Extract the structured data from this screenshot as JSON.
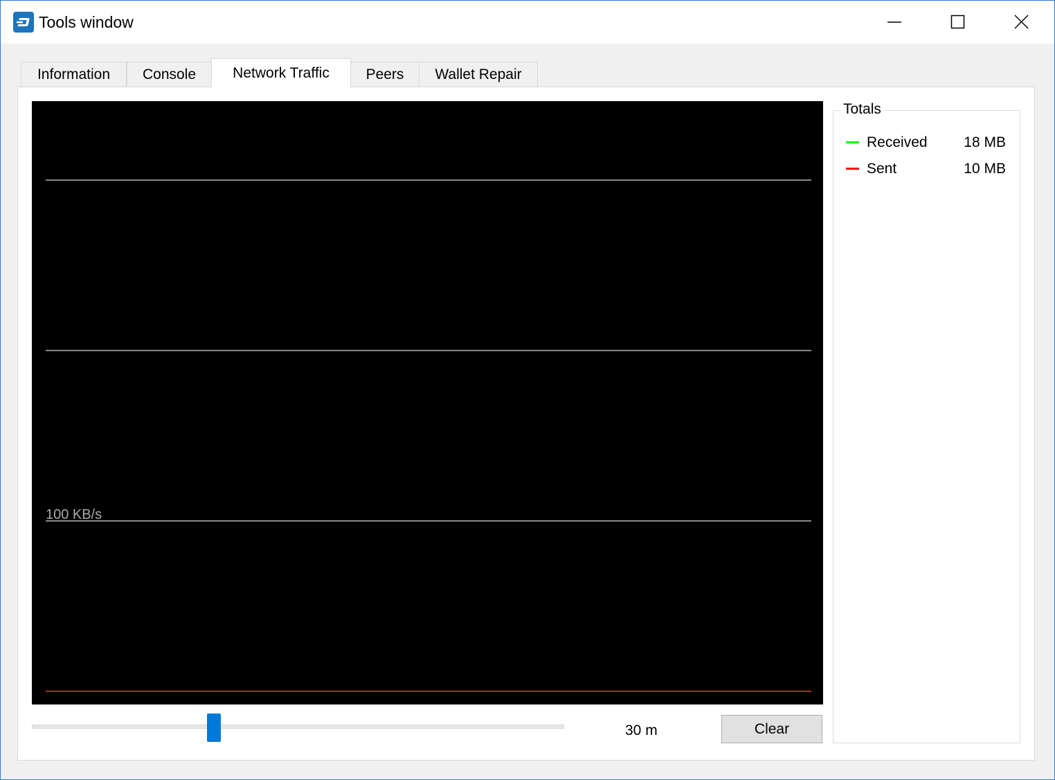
{
  "window": {
    "title": "Tools window",
    "accent": "#2b79d7",
    "app_icon": "dash-logo-icon",
    "controls": [
      "minimize-icon",
      "maximize-icon",
      "close-icon"
    ]
  },
  "tabs": [
    {
      "label": "Information",
      "active": false
    },
    {
      "label": "Console",
      "active": false
    },
    {
      "label": "Network Traffic",
      "active": true
    },
    {
      "label": "Peers",
      "active": false
    },
    {
      "label": "Wallet Repair",
      "active": false
    }
  ],
  "traffic": {
    "scale_label": "100 KB/s",
    "slider_value": "30 m",
    "clear_label": "Clear",
    "slider_position": 0.338
  },
  "totals": {
    "title": "Totals",
    "received": {
      "label": "Received",
      "value": "18 MB",
      "color": "#00ff00"
    },
    "sent": {
      "label": "Sent",
      "value": "10 MB",
      "color": "#ff0000"
    }
  },
  "chart_data": {
    "type": "area",
    "ylabel": "",
    "gridline_kbps": [
      100,
      200,
      300
    ],
    "ylim": [
      0,
      337
    ],
    "x_samples": 100,
    "series": [
      {
        "name": "Received",
        "color": "#00ff00",
        "values": [
          0,
          0,
          0,
          0,
          0,
          0,
          0,
          0,
          0,
          0,
          0,
          0,
          0,
          0,
          0,
          0,
          0,
          0,
          0,
          0,
          0,
          0,
          0,
          0,
          0,
          0,
          0,
          0,
          0,
          0,
          0,
          0,
          0,
          0,
          0,
          0,
          0,
          0,
          0,
          0,
          0,
          0,
          0,
          0,
          0,
          0,
          0,
          0,
          0,
          0,
          0,
          0,
          0,
          0,
          0,
          0,
          0,
          0,
          0,
          0,
          0,
          0,
          0,
          0,
          0,
          0,
          0,
          0,
          0,
          0,
          0,
          0,
          0,
          0,
          0,
          0,
          0,
          0,
          0,
          0,
          0,
          0,
          0,
          0,
          0,
          0,
          0,
          0,
          0,
          0,
          0,
          0,
          0,
          0,
          0,
          0,
          0,
          0,
          0,
          0
        ]
      },
      {
        "name": "Sent",
        "color": "#ff0000",
        "values": [
          0,
          0,
          0,
          0,
          0,
          0,
          0,
          0,
          0,
          0,
          0,
          0,
          0,
          0,
          0,
          0,
          0,
          0,
          0,
          0,
          0,
          0,
          0,
          0,
          0,
          0,
          0,
          0,
          0,
          0,
          0,
          0,
          0,
          0,
          0,
          0,
          0,
          0,
          0,
          0,
          0,
          0,
          0,
          0,
          0,
          0,
          0,
          0,
          0,
          0,
          0,
          0,
          0,
          0,
          0,
          0,
          0,
          0,
          0,
          0,
          0,
          0,
          0,
          0,
          0,
          0,
          0,
          0,
          0,
          0,
          0,
          0,
          0,
          0,
          0,
          0,
          0,
          0,
          0,
          0,
          0,
          0,
          0,
          0,
          0,
          0,
          0,
          0,
          0,
          0,
          0,
          0,
          0,
          0,
          0,
          0,
          0,
          0,
          0,
          0
        ]
      }
    ]
  }
}
